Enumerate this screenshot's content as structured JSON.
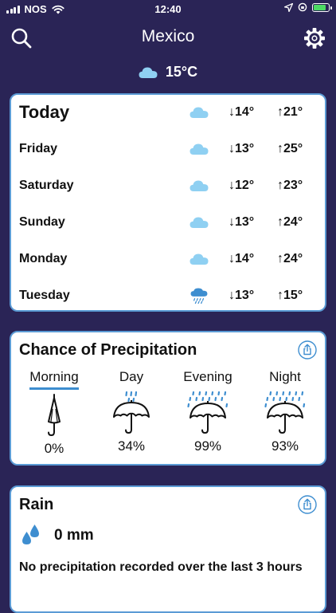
{
  "status": {
    "carrier": "NOS",
    "time": "12:40"
  },
  "header": {
    "title": "Mexico"
  },
  "current": {
    "temperature": "15°C",
    "icon": "cloud-icon"
  },
  "forecast": [
    {
      "day": "Today",
      "icon": "cloud-icon",
      "low": "↓14°",
      "high": "↑21°"
    },
    {
      "day": "Friday",
      "icon": "cloud-icon",
      "low": "↓13°",
      "high": "↑25°"
    },
    {
      "day": "Saturday",
      "icon": "cloud-icon",
      "low": "↓12°",
      "high": "↑23°"
    },
    {
      "day": "Sunday",
      "icon": "cloud-icon",
      "low": "↓13°",
      "high": "↑24°"
    },
    {
      "day": "Monday",
      "icon": "cloud-icon",
      "low": "↓14°",
      "high": "↑24°"
    },
    {
      "day": "Tuesday",
      "icon": "rain-cloud-icon",
      "low": "↓13°",
      "high": "↑15°"
    }
  ],
  "precipitation": {
    "title": "Chance of Precipitation",
    "periods": [
      {
        "label": "Morning",
        "value": "0%",
        "icon": "closed-umbrella-icon",
        "selected": true
      },
      {
        "label": "Day",
        "value": "34%",
        "icon": "umbrella-light-rain-icon",
        "selected": false
      },
      {
        "label": "Evening",
        "value": "99%",
        "icon": "umbrella-heavy-rain-icon",
        "selected": false
      },
      {
        "label": "Night",
        "value": "93%",
        "icon": "umbrella-heavy-rain-icon",
        "selected": false
      }
    ]
  },
  "rain": {
    "title": "Rain",
    "amount": "0 mm",
    "note": "No precipitation recorded over the last 3 hours"
  },
  "colors": {
    "background": "#2a2456",
    "card_border": "#5b9bd5",
    "accent": "#3e8ed0",
    "cloud": "#8fd0f2"
  }
}
